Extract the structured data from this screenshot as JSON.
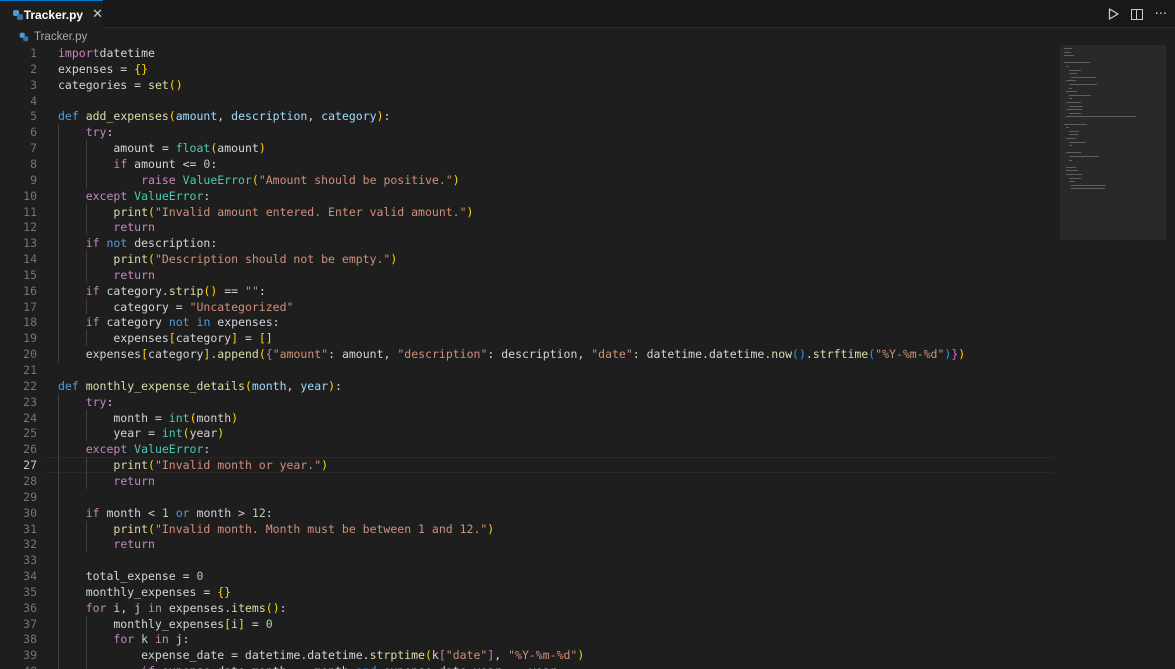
{
  "tab": {
    "label": "Tracker.py",
    "close": "✕",
    "icon": "python-file-icon"
  },
  "actions": {
    "run": "run-icon",
    "split": "split-editor-icon",
    "more": "···"
  },
  "breadcrumb": {
    "file": "Tracker.py"
  },
  "active_line": 27,
  "colors": {
    "background": "#1e1e1e",
    "keyword": "#c586c0",
    "storage": "#569cd6",
    "function": "#dcdcaa",
    "class": "#4ec9b0",
    "string": "#ce9178",
    "number": "#b5cea8",
    "variable": "#9cdcfe",
    "accent": "#0078d4"
  },
  "lines": [
    [
      [
        "kw",
        "import"
      ],
      [
        "",
        "datetime"
      ]
    ],
    [
      [
        "",
        "expenses = "
      ],
      [
        "b1",
        "{}"
      ]
    ],
    [
      [
        "",
        "categories = "
      ],
      [
        "fn",
        "set"
      ],
      [
        "b1",
        "()"
      ]
    ],
    [],
    [
      [
        "kb",
        "def "
      ],
      [
        "fn",
        "add_expenses"
      ],
      [
        "b1",
        "("
      ],
      [
        "va",
        "amount"
      ],
      [
        "",
        ", "
      ],
      [
        "va",
        "description"
      ],
      [
        "",
        ", "
      ],
      [
        "va",
        "category"
      ],
      [
        "b1",
        ")"
      ],
      [
        "",
        ":"
      ]
    ],
    [
      [
        "",
        "    "
      ],
      [
        "kw",
        "try"
      ],
      [
        "",
        ":"
      ]
    ],
    [
      [
        "",
        "        amount = "
      ],
      [
        "cl",
        "float"
      ],
      [
        "b1",
        "("
      ],
      [
        "",
        "amount"
      ],
      [
        "b1",
        ")"
      ]
    ],
    [
      [
        "",
        "        "
      ],
      [
        "kw",
        "if"
      ],
      [
        "",
        " amount <= "
      ],
      [
        "nu",
        "0"
      ],
      [
        "",
        ":"
      ]
    ],
    [
      [
        "",
        "            "
      ],
      [
        "kw",
        "raise"
      ],
      [
        "",
        ""
      ],
      [
        "cl",
        " ValueError"
      ],
      [
        "b1",
        "("
      ],
      [
        "st",
        "\"Amount should be positive.\""
      ],
      [
        "b1",
        ")"
      ]
    ],
    [
      [
        "",
        "    "
      ],
      [
        "kw",
        "except"
      ],
      [
        "cl",
        " ValueError"
      ],
      [
        "",
        ":"
      ]
    ],
    [
      [
        "",
        "        "
      ],
      [
        "fn",
        "print"
      ],
      [
        "b1",
        "("
      ],
      [
        "st",
        "\"Invalid amount entered. Enter valid amount.\""
      ],
      [
        "b1",
        ")"
      ]
    ],
    [
      [
        "",
        "        "
      ],
      [
        "kw",
        "return"
      ]
    ],
    [
      [
        "",
        "    "
      ],
      [
        "kw",
        "if"
      ],
      [
        "kb",
        " not"
      ],
      [
        "",
        " description:"
      ]
    ],
    [
      [
        "",
        "        "
      ],
      [
        "fn",
        "print"
      ],
      [
        "b1",
        "("
      ],
      [
        "st",
        "\"Description should not be empty.\""
      ],
      [
        "b1",
        ")"
      ]
    ],
    [
      [
        "",
        "        "
      ],
      [
        "kw",
        "return"
      ]
    ],
    [
      [
        "",
        "    "
      ],
      [
        "kw",
        "if"
      ],
      [
        "",
        " category."
      ],
      [
        "fn",
        "strip"
      ],
      [
        "b1",
        "()"
      ],
      [
        "",
        " == "
      ],
      [
        "st",
        "\"\""
      ],
      [
        "",
        ":"
      ]
    ],
    [
      [
        "",
        "        category = "
      ],
      [
        "st",
        "\"Uncategorized\""
      ]
    ],
    [
      [
        "",
        "    "
      ],
      [
        "kw",
        "if"
      ],
      [
        "",
        " category "
      ],
      [
        "kb",
        "not"
      ],
      [
        " ",
        ""
      ],
      [
        "kb",
        " in"
      ],
      [
        "",
        " expenses:"
      ]
    ],
    [
      [
        "",
        "        expenses"
      ],
      [
        "b1",
        "["
      ],
      [
        "",
        "category"
      ],
      [
        "b1",
        "]"
      ],
      [
        "",
        " = "
      ],
      [
        "b1",
        "[]"
      ]
    ],
    [
      [
        "",
        "    expenses"
      ],
      [
        "b1",
        "["
      ],
      [
        "",
        "category"
      ],
      [
        "b1",
        "]"
      ],
      [
        "",
        "."
      ],
      [
        "fn",
        "append"
      ],
      [
        "b1",
        "("
      ],
      [
        "b2",
        "{"
      ],
      [
        "st",
        "\"amount\""
      ],
      [
        "",
        ": amount, "
      ],
      [
        "st",
        "\"description\""
      ],
      [
        "",
        ": description, "
      ],
      [
        "st",
        "\"date\""
      ],
      [
        "",
        ": datetime.datetime."
      ],
      [
        "fn",
        "now"
      ],
      [
        "b3",
        "()"
      ],
      [
        "",
        "."
      ],
      [
        "fn",
        "strftime"
      ],
      [
        "b3",
        "("
      ],
      [
        "st",
        "\"%Y-%m-%d\""
      ],
      [
        "b3",
        ")"
      ],
      [
        "b2",
        "}"
      ],
      [
        "b1",
        ")"
      ]
    ],
    [],
    [
      [
        "kb",
        "def "
      ],
      [
        "fn",
        "monthly_expense_details"
      ],
      [
        "b1",
        "("
      ],
      [
        "va",
        "month"
      ],
      [
        "",
        ", "
      ],
      [
        "va",
        "year"
      ],
      [
        "b1",
        ")"
      ],
      [
        "",
        ":"
      ]
    ],
    [
      [
        "",
        "    "
      ],
      [
        "kw",
        "try"
      ],
      [
        "",
        ":"
      ]
    ],
    [
      [
        "",
        "        month = "
      ],
      [
        "cl",
        "int"
      ],
      [
        "b1",
        "("
      ],
      [
        "",
        "month"
      ],
      [
        "b1",
        ")"
      ]
    ],
    [
      [
        "",
        "        year = "
      ],
      [
        "cl",
        "int"
      ],
      [
        "b1",
        "("
      ],
      [
        "",
        "year"
      ],
      [
        "b1",
        ")"
      ]
    ],
    [
      [
        "",
        "    "
      ],
      [
        "kw",
        "except"
      ],
      [
        "cl",
        " ValueError"
      ],
      [
        "",
        ":"
      ]
    ],
    [
      [
        "",
        "        "
      ],
      [
        "fn",
        "print"
      ],
      [
        "b1",
        "("
      ],
      [
        "st",
        "\"Invalid month or year.\""
      ],
      [
        "b1",
        ")"
      ]
    ],
    [
      [
        "",
        "        "
      ],
      [
        "kw",
        "return"
      ]
    ],
    [],
    [
      [
        "",
        "    "
      ],
      [
        "kw",
        "if"
      ],
      [
        "",
        " month < "
      ],
      [
        "nu",
        "1"
      ],
      [
        "kb",
        " or"
      ],
      [
        "",
        " month > "
      ],
      [
        "nu",
        "12"
      ],
      [
        "",
        ":"
      ]
    ],
    [
      [
        "",
        "        "
      ],
      [
        "fn",
        "print"
      ],
      [
        "b1",
        "("
      ],
      [
        "st",
        "\"Invalid month. Month must be between 1 and 12.\""
      ],
      [
        "b1",
        ")"
      ]
    ],
    [
      [
        "",
        "        "
      ],
      [
        "kw",
        "return"
      ]
    ],
    [],
    [
      [
        "",
        "    total_expense = "
      ],
      [
        "nu",
        "0"
      ]
    ],
    [
      [
        "",
        "    monthly_expenses = "
      ],
      [
        "b1",
        "{}"
      ]
    ],
    [
      [
        "",
        "    "
      ],
      [
        "kw",
        "for"
      ],
      [
        "",
        " i, j "
      ],
      [
        "kw",
        "in"
      ],
      [
        "",
        " expenses."
      ],
      [
        "fn",
        "items"
      ],
      [
        "b1",
        "()"
      ],
      [
        "",
        ":"
      ]
    ],
    [
      [
        "",
        "        monthly_expenses"
      ],
      [
        "b1",
        "["
      ],
      [
        "",
        "i"
      ],
      [
        "b1",
        "]"
      ],
      [
        "",
        " = "
      ],
      [
        "nu",
        "0"
      ]
    ],
    [
      [
        "",
        "        "
      ],
      [
        "kw",
        "for"
      ],
      [
        "",
        " k "
      ],
      [
        "kw",
        "in"
      ],
      [
        "",
        " j:"
      ]
    ],
    [
      [
        "",
        "            expense_date = datetime.datetime."
      ],
      [
        "fn",
        "strptime"
      ],
      [
        "b1",
        "("
      ],
      [
        "",
        "k"
      ],
      [
        "b2",
        "["
      ],
      [
        "st",
        "\"date\""
      ],
      [
        "b2",
        "]"
      ],
      [
        "",
        ", "
      ],
      [
        "st",
        "\"%Y-%m-%d\""
      ],
      [
        "b1",
        ")"
      ]
    ],
    [
      [
        "",
        "            "
      ],
      [
        "kw",
        "if"
      ],
      [
        "",
        " expense_date.month == month "
      ],
      [
        "kb",
        "and"
      ],
      [
        "",
        " expense_date.year == year:"
      ]
    ]
  ]
}
